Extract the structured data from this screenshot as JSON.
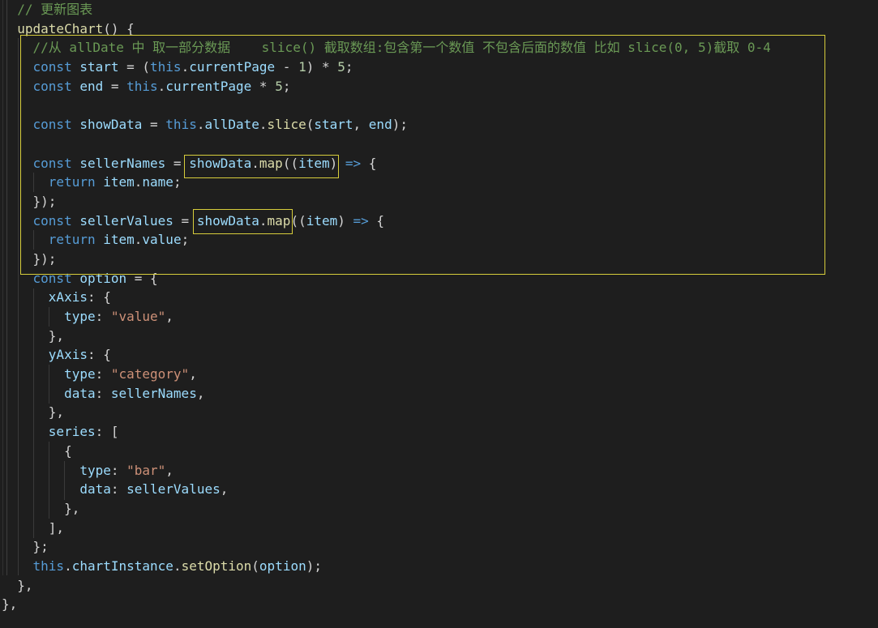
{
  "editor": {
    "background": "#1e1e1e",
    "palette": {
      "bg": "#1e1e1e",
      "kw": "#569cd6",
      "var": "#9cdcfe",
      "fn": "#dcdcaa",
      "str": "#ce9178",
      "num": "#b5cea8",
      "com": "#6a9955",
      "pun": "#d4d4d4",
      "accent": "#d7cd3c"
    },
    "annotations": {
      "accent_color": "#d7cd3c",
      "boxes": [
        {
          "name": "highlight-box-large",
          "highlights": "slice/map data extraction block"
        },
        {
          "name": "highlight-box-seller-names",
          "highlights": "showData.map((item)"
        },
        {
          "name": "highlight-box-seller-values",
          "highlights": "showData.map"
        }
      ]
    },
    "code": {
      "lines": [
        {
          "indent": 2,
          "tokens": [
            [
              "com",
              "// 更新图表"
            ]
          ]
        },
        {
          "indent": 2,
          "tokens": [
            [
              "fn",
              "updateChart"
            ],
            [
              "pun",
              "() {"
            ]
          ]
        },
        {
          "indent": 4,
          "tokens": [
            [
              "com",
              "//从 allDate 中 取一部分数据    slice() 截取数组:包含第一个数值 不包含后面的数值 比如 slice(0, 5)截取 0-4"
            ]
          ]
        },
        {
          "indent": 4,
          "tokens": [
            [
              "kw",
              "const "
            ],
            [
              "var",
              "start"
            ],
            [
              "pun",
              " = ("
            ],
            [
              "kw",
              "this"
            ],
            [
              "pun",
              "."
            ],
            [
              "var",
              "currentPage"
            ],
            [
              "pun",
              " - "
            ],
            [
              "num",
              "1"
            ],
            [
              "pun",
              ") * "
            ],
            [
              "num",
              "5"
            ],
            [
              "pun",
              ";"
            ]
          ]
        },
        {
          "indent": 4,
          "tokens": [
            [
              "kw",
              "const "
            ],
            [
              "var",
              "end"
            ],
            [
              "pun",
              " = "
            ],
            [
              "kw",
              "this"
            ],
            [
              "pun",
              "."
            ],
            [
              "var",
              "currentPage"
            ],
            [
              "pun",
              " * "
            ],
            [
              "num",
              "5"
            ],
            [
              "pun",
              ";"
            ]
          ]
        },
        {
          "indent": 0,
          "tokens": []
        },
        {
          "indent": 4,
          "tokens": [
            [
              "kw",
              "const "
            ],
            [
              "var",
              "showData"
            ],
            [
              "pun",
              " = "
            ],
            [
              "kw",
              "this"
            ],
            [
              "pun",
              "."
            ],
            [
              "var",
              "allDate"
            ],
            [
              "pun",
              "."
            ],
            [
              "fn",
              "slice"
            ],
            [
              "pun",
              "("
            ],
            [
              "var",
              "start"
            ],
            [
              "pun",
              ", "
            ],
            [
              "var",
              "end"
            ],
            [
              "pun",
              ");"
            ]
          ]
        },
        {
          "indent": 0,
          "tokens": []
        },
        {
          "indent": 4,
          "tokens": [
            [
              "kw",
              "const "
            ],
            [
              "var",
              "sellerNames"
            ],
            [
              "pun",
              " = "
            ],
            [
              "var",
              "showData"
            ],
            [
              "pun",
              "."
            ],
            [
              "fn",
              "map"
            ],
            [
              "pun",
              "(("
            ],
            [
              "var",
              "item"
            ],
            [
              "pun",
              ") "
            ],
            [
              "kw",
              "=>"
            ],
            [
              "pun",
              " {"
            ]
          ]
        },
        {
          "indent": 6,
          "tokens": [
            [
              "kw",
              "return "
            ],
            [
              "var",
              "item"
            ],
            [
              "pun",
              "."
            ],
            [
              "var",
              "name"
            ],
            [
              "pun",
              ";"
            ]
          ]
        },
        {
          "indent": 4,
          "tokens": [
            [
              "pun",
              "});"
            ]
          ]
        },
        {
          "indent": 4,
          "tokens": [
            [
              "kw",
              "const "
            ],
            [
              "var",
              "sellerValues"
            ],
            [
              "pun",
              " = "
            ],
            [
              "var",
              "showData"
            ],
            [
              "pun",
              "."
            ],
            [
              "fn",
              "map"
            ],
            [
              "pun",
              "(("
            ],
            [
              "var",
              "item"
            ],
            [
              "pun",
              ") "
            ],
            [
              "kw",
              "=>"
            ],
            [
              "pun",
              " {"
            ]
          ]
        },
        {
          "indent": 6,
          "tokens": [
            [
              "kw",
              "return "
            ],
            [
              "var",
              "item"
            ],
            [
              "pun",
              "."
            ],
            [
              "var",
              "value"
            ],
            [
              "pun",
              ";"
            ]
          ]
        },
        {
          "indent": 4,
          "tokens": [
            [
              "pun",
              "});"
            ]
          ]
        },
        {
          "indent": 4,
          "tokens": [
            [
              "kw",
              "const "
            ],
            [
              "var",
              "option"
            ],
            [
              "pun",
              " = {"
            ]
          ]
        },
        {
          "indent": 6,
          "tokens": [
            [
              "var",
              "xAxis"
            ],
            [
              "pun",
              ": {"
            ]
          ]
        },
        {
          "indent": 8,
          "tokens": [
            [
              "var",
              "type"
            ],
            [
              "pun",
              ": "
            ],
            [
              "str",
              "\"value\""
            ],
            [
              "pun",
              ","
            ]
          ]
        },
        {
          "indent": 6,
          "tokens": [
            [
              "pun",
              "},"
            ]
          ]
        },
        {
          "indent": 6,
          "tokens": [
            [
              "var",
              "yAxis"
            ],
            [
              "pun",
              ": {"
            ]
          ]
        },
        {
          "indent": 8,
          "tokens": [
            [
              "var",
              "type"
            ],
            [
              "pun",
              ": "
            ],
            [
              "str",
              "\"category\""
            ],
            [
              "pun",
              ","
            ]
          ]
        },
        {
          "indent": 8,
          "tokens": [
            [
              "var",
              "data"
            ],
            [
              "pun",
              ": "
            ],
            [
              "var",
              "sellerNames"
            ],
            [
              "pun",
              ","
            ]
          ]
        },
        {
          "indent": 6,
          "tokens": [
            [
              "pun",
              "},"
            ]
          ]
        },
        {
          "indent": 6,
          "tokens": [
            [
              "var",
              "series"
            ],
            [
              "pun",
              ": ["
            ]
          ]
        },
        {
          "indent": 8,
          "tokens": [
            [
              "pun",
              "{"
            ]
          ]
        },
        {
          "indent": 10,
          "tokens": [
            [
              "var",
              "type"
            ],
            [
              "pun",
              ": "
            ],
            [
              "str",
              "\"bar\""
            ],
            [
              "pun",
              ","
            ]
          ]
        },
        {
          "indent": 10,
          "tokens": [
            [
              "var",
              "data"
            ],
            [
              "pun",
              ": "
            ],
            [
              "var",
              "sellerValues"
            ],
            [
              "pun",
              ","
            ]
          ]
        },
        {
          "indent": 8,
          "tokens": [
            [
              "pun",
              "},"
            ]
          ]
        },
        {
          "indent": 6,
          "tokens": [
            [
              "pun",
              "],"
            ]
          ]
        },
        {
          "indent": 4,
          "tokens": [
            [
              "pun",
              "};"
            ]
          ]
        },
        {
          "indent": 4,
          "tokens": [
            [
              "kw",
              "this"
            ],
            [
              "pun",
              "."
            ],
            [
              "var",
              "chartInstance"
            ],
            [
              "pun",
              "."
            ],
            [
              "fn",
              "setOption"
            ],
            [
              "pun",
              "("
            ],
            [
              "var",
              "option"
            ],
            [
              "pun",
              ");"
            ]
          ]
        },
        {
          "indent": 2,
          "tokens": [
            [
              "pun",
              "},"
            ]
          ]
        },
        {
          "indent": 0,
          "tokens": [
            [
              "pun",
              "},"
            ]
          ]
        }
      ]
    }
  }
}
